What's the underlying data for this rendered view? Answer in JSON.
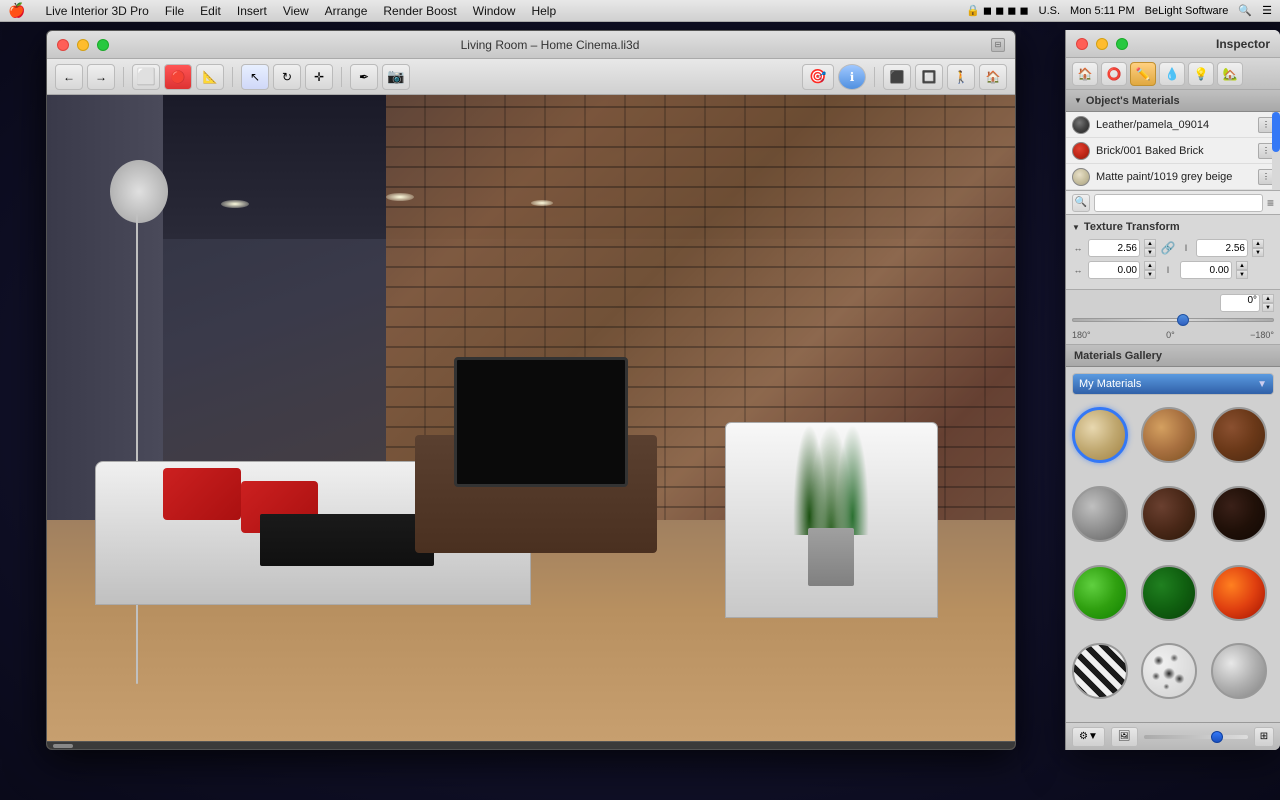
{
  "menubar": {
    "apple": "🍎",
    "items": [
      {
        "label": "Live Interior 3D Pro"
      },
      {
        "label": "File"
      },
      {
        "label": "Edit"
      },
      {
        "label": "Insert"
      },
      {
        "label": "View"
      },
      {
        "label": "Arrange"
      },
      {
        "label": "Render Boost"
      },
      {
        "label": "Window"
      },
      {
        "label": "Help"
      }
    ],
    "right": {
      "time": "Mon 5:11 PM",
      "app": "BeLight Software"
    }
  },
  "window": {
    "title": "Living Room – Home Cinema.li3d",
    "traffic_lights": [
      "close",
      "minimize",
      "maximize"
    ]
  },
  "inspector": {
    "title": "Inspector",
    "tabs": [
      {
        "label": "🏠",
        "icon": "home-icon",
        "active": false
      },
      {
        "label": "⭕",
        "icon": "sphere-icon",
        "active": false
      },
      {
        "label": "✏️",
        "icon": "paint-icon",
        "active": true
      },
      {
        "label": "💧",
        "icon": "material-icon",
        "active": false
      },
      {
        "label": "💡",
        "icon": "light-icon",
        "active": false
      },
      {
        "label": "🏡",
        "icon": "house-icon",
        "active": false
      }
    ],
    "objects_materials": {
      "header": "Object's Materials",
      "items": [
        {
          "name": "Leather/pamela_09014",
          "color": "#555555",
          "color_style": "gray"
        },
        {
          "name": "Brick/001 Baked Brick",
          "color": "#cc3020",
          "color_style": "red"
        },
        {
          "name": "Matte paint/1019 grey beige",
          "color": "#d0c8b0",
          "color_style": "beige"
        }
      ]
    },
    "texture_transform": {
      "header": "Texture Transform",
      "scale_x": "2.56",
      "scale_y": "2.56",
      "offset_x": "0.00",
      "offset_y": "0.00",
      "rotation": "0°",
      "rotation_min": "180°",
      "rotation_mid": "0°",
      "rotation_max": "−180°"
    },
    "materials_gallery": {
      "header": "Materials Gallery",
      "dropdown_label": "My Materials",
      "items": [
        {
          "id": 1,
          "style": "mat-beige",
          "label": "Beige",
          "selected": true
        },
        {
          "id": 2,
          "style": "mat-wood-light",
          "label": "Light Wood",
          "selected": false
        },
        {
          "id": 3,
          "style": "mat-wood-dark",
          "label": "Dark Wood",
          "selected": false
        },
        {
          "id": 4,
          "style": "mat-concrete",
          "label": "Concrete",
          "selected": false
        },
        {
          "id": 5,
          "style": "mat-brown-dark",
          "label": "Brown",
          "selected": false
        },
        {
          "id": 6,
          "style": "mat-dark-brown",
          "label": "Dark Brown",
          "selected": false
        },
        {
          "id": 7,
          "style": "mat-green-bright",
          "label": "Green Bright",
          "selected": false
        },
        {
          "id": 8,
          "style": "mat-green-dark",
          "label": "Green Dark",
          "selected": false
        },
        {
          "id": 9,
          "style": "mat-fire",
          "label": "Fire",
          "selected": false
        },
        {
          "id": 10,
          "style": "mat-zebra",
          "label": "Zebra",
          "selected": false
        },
        {
          "id": 11,
          "style": "mat-spots",
          "label": "Spots",
          "selected": false
        },
        {
          "id": 12,
          "style": "mat-silver",
          "label": "Silver",
          "selected": false
        }
      ]
    },
    "footer": {
      "gear_label": "⚙",
      "image_label": "🖼"
    }
  },
  "toolbar": {
    "nav_back": "←",
    "nav_forward": "→",
    "tool_floor": "⬜",
    "tool_wall": "🔴",
    "tool_room": "📐",
    "tool_select": "↖",
    "tool_rotate": "↻",
    "tool_move": "✛",
    "tool_pen": "✒",
    "tool_camera": "📷",
    "view_2d": "⬛",
    "view_3d": "🔲",
    "view_walk": "🚶",
    "view_home": "🏠",
    "btn_3d_view": "🎯",
    "btn_info": "ℹ"
  }
}
